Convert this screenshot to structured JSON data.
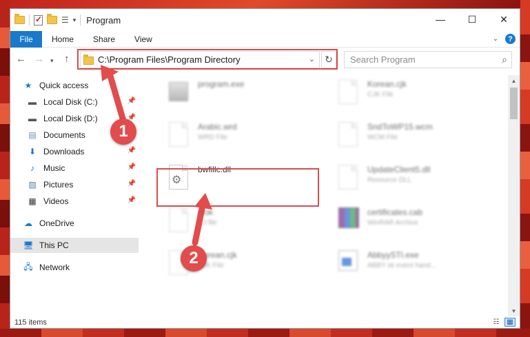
{
  "titlebar": {
    "title": "Program",
    "min": "—",
    "max": "☐",
    "close": "✕"
  },
  "ribbon": {
    "tabs": [
      "File",
      "Home",
      "Share",
      "View"
    ],
    "help": "?"
  },
  "nav": {
    "back": "←",
    "forward": "→",
    "up": "↑",
    "address": "C:\\Program Files\\Program Directory",
    "search_placeholder": "Search Program"
  },
  "sidebar": {
    "items": [
      {
        "label": "Quick access",
        "icon": "star-icon",
        "pinned": false
      },
      {
        "label": "Local Disk (C:)",
        "icon": "drive-icon",
        "pinned": true
      },
      {
        "label": "Local Disk (D:)",
        "icon": "drive-icon",
        "pinned": true
      },
      {
        "label": "Documents",
        "icon": "documents-icon",
        "pinned": true
      },
      {
        "label": "Downloads",
        "icon": "download-icon",
        "pinned": true
      },
      {
        "label": "Music",
        "icon": "music-icon",
        "pinned": true
      },
      {
        "label": "Pictures",
        "icon": "pictures-icon",
        "pinned": true
      },
      {
        "label": "Videos",
        "icon": "videos-icon",
        "pinned": true
      },
      {
        "label": "OneDrive",
        "icon": "cloud-icon",
        "pinned": false
      },
      {
        "label": "This PC",
        "icon": "computer-icon",
        "pinned": false
      },
      {
        "label": "Network",
        "icon": "network-icon",
        "pinned": false
      }
    ]
  },
  "files": [
    {
      "name": "program.exe",
      "type": ""
    },
    {
      "name": "Korean.cjk",
      "type": "CJK File"
    },
    {
      "name": "Arabic.wrd",
      "type": "WRD File"
    },
    {
      "name": "SndToWP15.wcm",
      "type": "WCM File"
    },
    {
      "name": "bwfillc.dll",
      "type": ""
    },
    {
      "name": "UpdateClient5.dll",
      "type": "Resource DLL"
    },
    {
      "name": "glok",
      "type": "CJ file"
    },
    {
      "name": "certificates.cab",
      "type": "WinRAR Archive"
    },
    {
      "name": "Korean.cjk",
      "type": "CJK File"
    },
    {
      "name": "AbbyySTI.exe",
      "type": "ABBY sti event hand..."
    }
  ],
  "status": {
    "count": "115 items"
  },
  "annotations": {
    "step1": "1",
    "step2": "2",
    "accent": "#e24c4c"
  }
}
